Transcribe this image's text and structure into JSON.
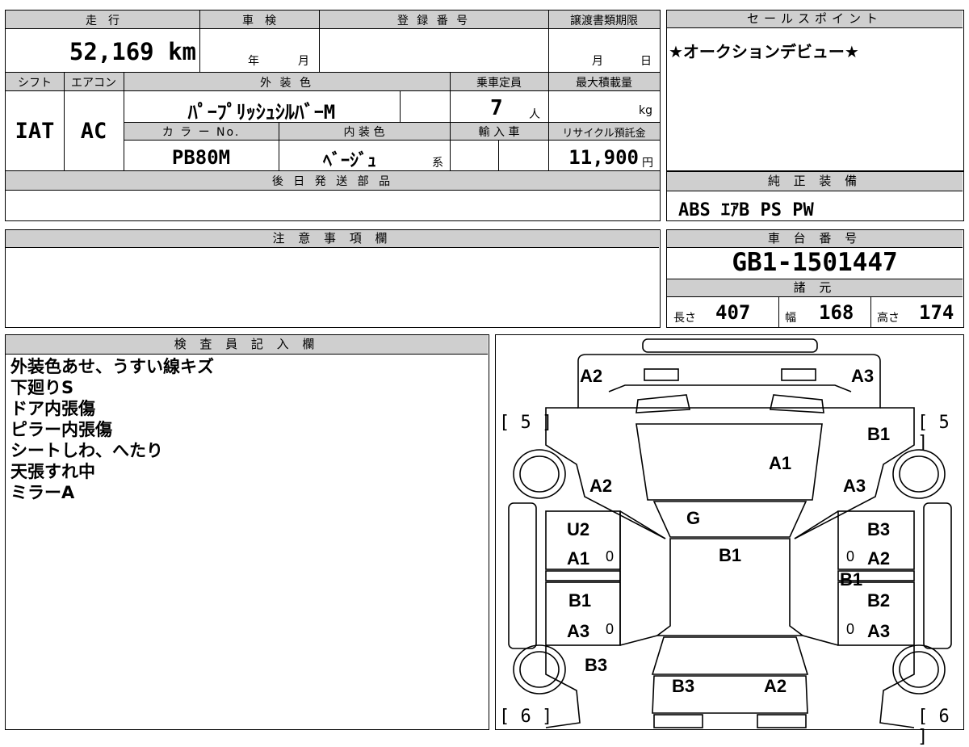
{
  "top_table": {
    "mileage_header": "走　行",
    "mileage_value": "52,169 km",
    "inspection_header": "車　検",
    "inspection_year": "年",
    "inspection_month": "月",
    "registration_header": "登 録 番 号",
    "registration_value": "",
    "transfer_deadline_header": "譲渡書類期限",
    "transfer_month": "月",
    "transfer_day": "日",
    "shift_header": "シフト",
    "shift_value": "IAT",
    "ac_header": "エアコン",
    "ac_value": "AC",
    "exterior_color_header": "外 装 色",
    "exterior_color_value": "ﾊﾟｰﾌﾟﾘｯｼｭｼﾙﾊﾞｰM",
    "capacity_header": "乗車定員",
    "capacity_value": "7",
    "capacity_unit": "人",
    "max_load_header": "最大積載量",
    "max_load_unit": "kg",
    "color_no_header": "カ ラ ー No.",
    "color_no_value": "PB80M",
    "interior_color_header": "内 装 色",
    "interior_color_value": "ﾍﾞｰｼﾞｭ",
    "interior_color_suffix": "系",
    "import_header": "輸 入 車",
    "recycle_header": "リサイクル預託金",
    "recycle_value": "11,900",
    "recycle_unit": "円",
    "later_parts_header": "後 日 発 送 部 品"
  },
  "sales_point": {
    "header": "セールスポイント",
    "text": "★オークションデビュー★"
  },
  "genuine_equipment": {
    "header": "純 正 装 備",
    "text": "ABS ｴｱB PS PW"
  },
  "notes": {
    "header": "注 意 事 項 欄"
  },
  "chassis": {
    "header": "車 台 番 号",
    "value": "GB1-1501447"
  },
  "specs": {
    "header": "諸 元",
    "length_label": "長さ",
    "length_value": "407",
    "width_label": "幅",
    "width_value": "168",
    "height_label": "高さ",
    "height_value": "174"
  },
  "inspector": {
    "header": "検 査 員 記 入 欄",
    "lines": [
      "外装色あせ、うすい線キズ",
      "下廻りS",
      "ドア内張傷",
      "ピラー内張傷",
      "シートしわ、へたり",
      "天張すれ中",
      "ミラーA"
    ]
  },
  "diagram": {
    "section_labels": [
      "[ 5 ]",
      "[ 5 ]",
      "[ 6 ]",
      "[ 6 ]"
    ],
    "marks": [
      "A2",
      "A3",
      "B1",
      "A1",
      "A2",
      "A3",
      "G",
      "U2",
      "B3",
      "B1",
      "A1",
      "0",
      "0",
      "A2",
      "B1",
      "B1",
      "B2",
      "A3",
      "0",
      "0",
      "A3",
      "B3",
      "B3",
      "A2"
    ]
  }
}
